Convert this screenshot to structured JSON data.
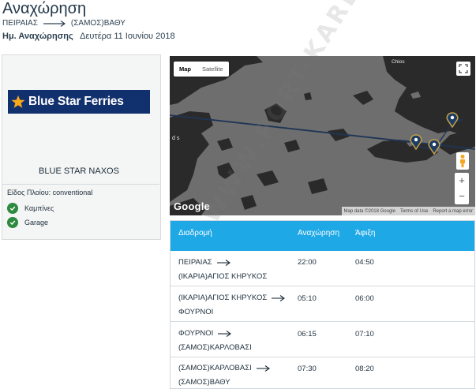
{
  "header": {
    "title": "Αναχώρηση",
    "from": "ΠΕΙΡΑΙΑΣ",
    "to": "(ΣΑΜΟΣ)ΒΑΘΥ",
    "date_label": "Ημ. Αναχώρησης",
    "date_value": "Δευτέρα 11 Ιουνίου 2018"
  },
  "ship": {
    "logo_text": "Blue Star Ferries",
    "logo_bg": "#11306e",
    "logo_star_color": "#f7a81b",
    "name": "BLUE STAR NAXOS",
    "type_label": "Είδος Πλοίου:",
    "type_value": "conventional",
    "features": [
      "Καμπίνες",
      "Garage"
    ],
    "check_color": "#2d8a3f"
  },
  "map": {
    "btn_map": "Map",
    "btn_satellite": "Satellite",
    "place_chios": "Chios",
    "place_ds": "d s",
    "google_logo": "Google",
    "footer": [
      "Map data ©2018 Google",
      "Terms of Use",
      "Report a map error"
    ],
    "zoom_in": "+",
    "zoom_out": "−",
    "icons": [
      "fullscreen-icon",
      "pegman-icon",
      "map-marker-icon"
    ]
  },
  "schedule": {
    "header_color": "#1ea8e6",
    "columns": [
      "Διαδρομή",
      "Αναχώρηση",
      "Άφιξη"
    ],
    "rows": [
      {
        "from": "ΠΕΙΡΑΙΑΣ",
        "to": "(ΙΚΑΡΙΑ)ΑΓΙΟΣ ΚΗΡΥΚΟΣ",
        "dep": "22:00",
        "arr": "04:50"
      },
      {
        "from": "(ΙΚΑΡΙΑ)ΑΓΙΟΣ ΚΗΡΥΚΟΣ",
        "to": "ΦΟΥΡΝΟΙ",
        "dep": "05:10",
        "arr": "06:00"
      },
      {
        "from": "ΦΟΥΡΝΟΙ",
        "to": "(ΣΑΜΟΣ)ΚΑΡΛΟΒΑΣΙ",
        "dep": "06:15",
        "arr": "07:10"
      },
      {
        "from": "(ΣΑΜΟΣ)ΚΑΡΛΟΒΑΣΙ",
        "to": "(ΣΑΜΟΣ)ΒΑΘΥ",
        "dep": "07:30",
        "arr": "08:20"
      }
    ]
  },
  "watermark": "WWW.PORT-KARLOVASI"
}
